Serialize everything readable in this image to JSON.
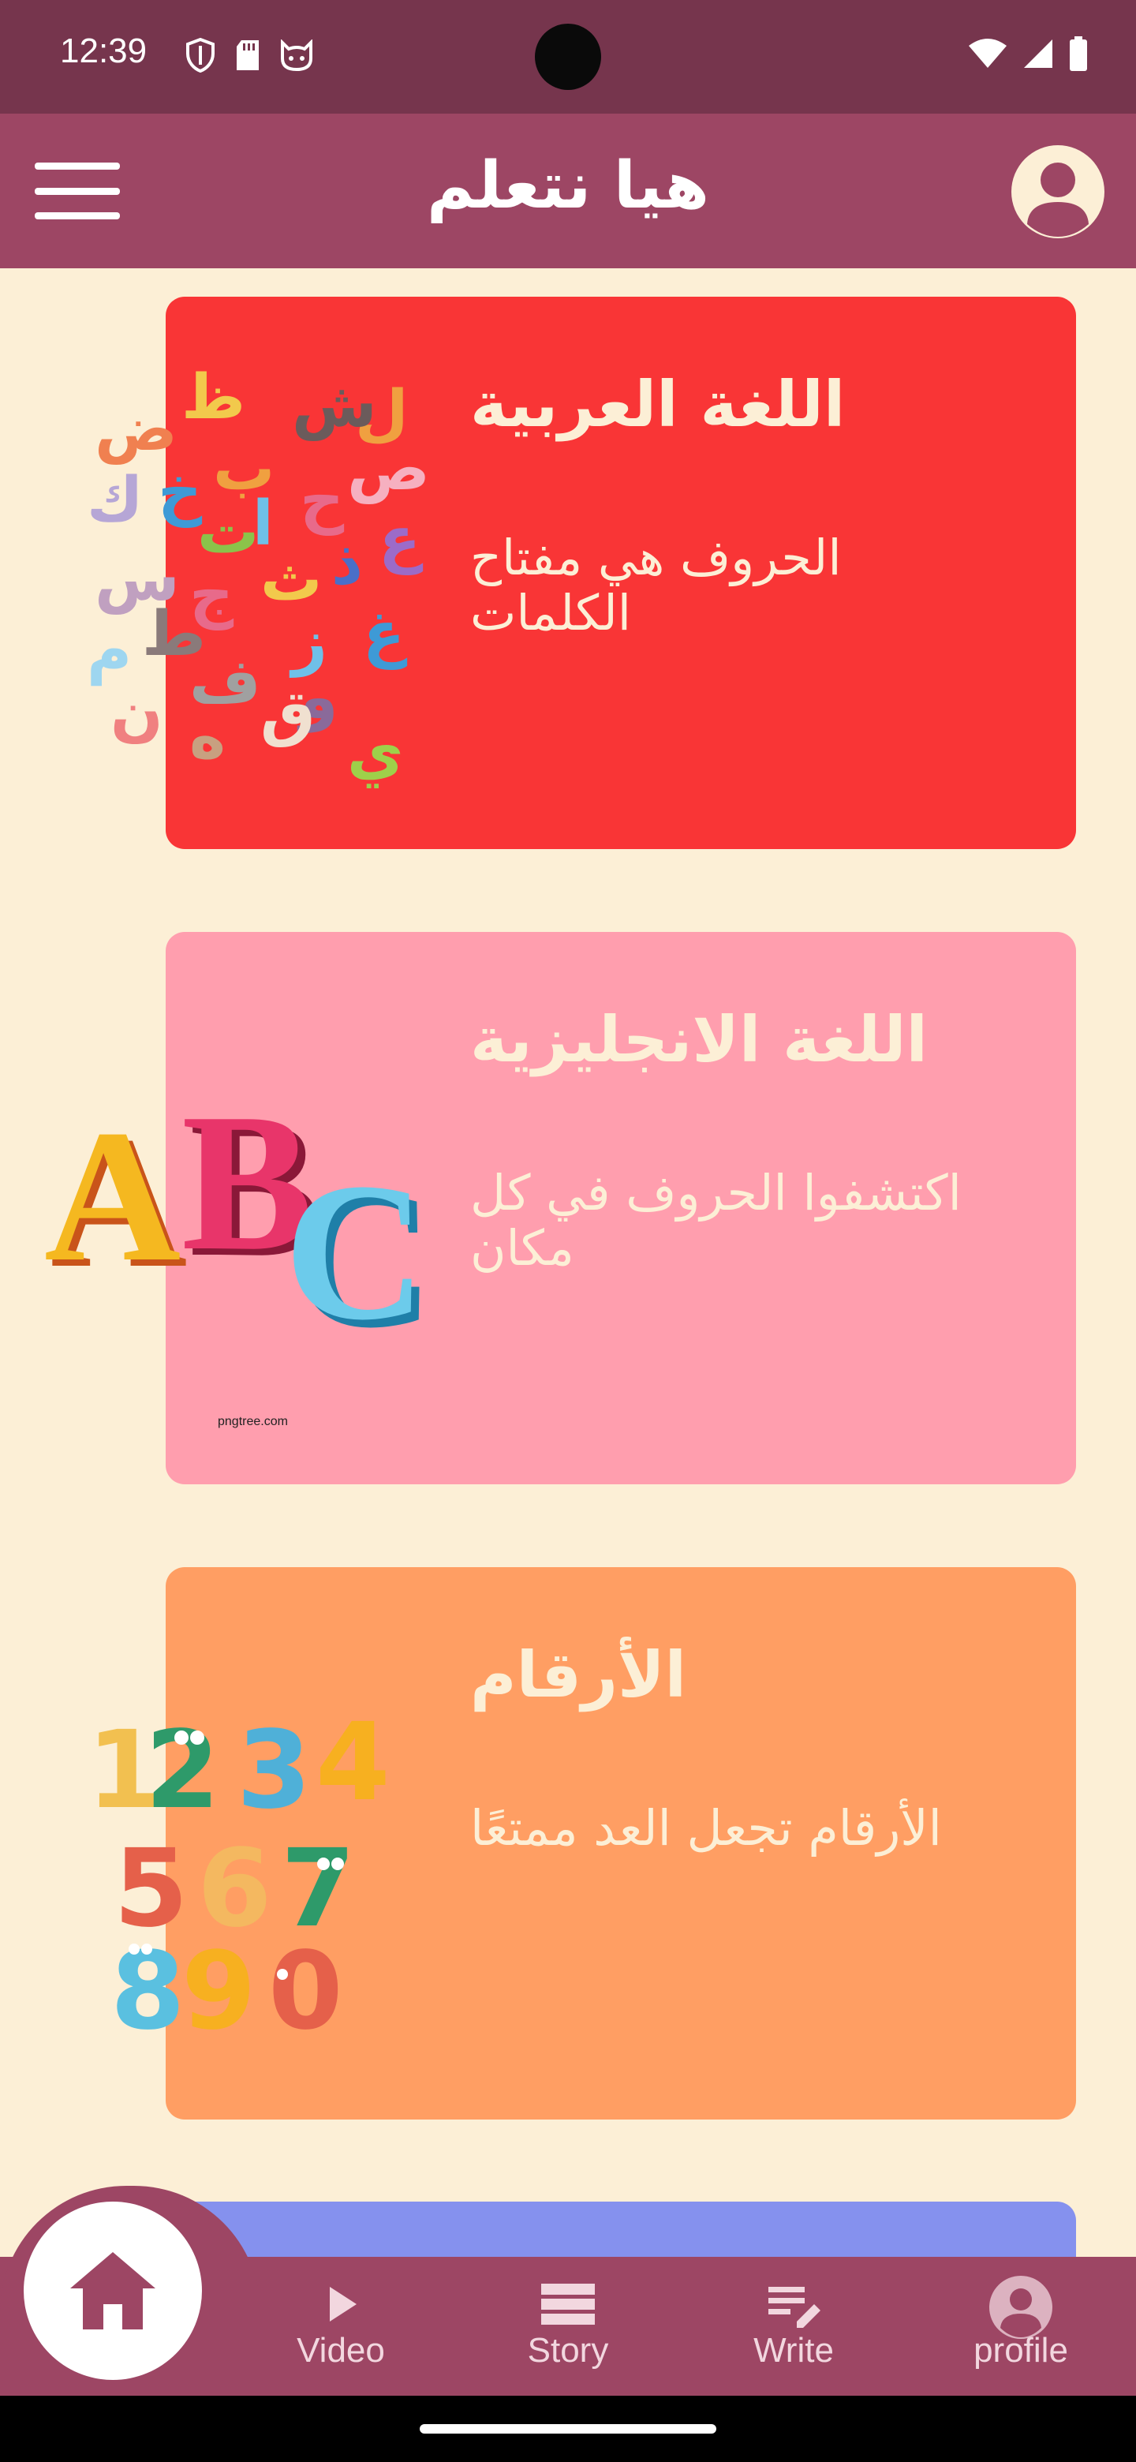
{
  "status_bar": {
    "time": "12:39"
  },
  "app_bar": {
    "title": "هيا نتعلم"
  },
  "cards": [
    {
      "title": "اللغة العربية",
      "description": "الحروف هي مفتاح الكلمات",
      "color": "#F93536"
    },
    {
      "title": "اللغة الانجليزية",
      "description": "اكتشفوا الحروف في كل مكان",
      "color": "#FF9EAE",
      "watermark": "pngtree.com",
      "art_text": [
        "A",
        "B",
        "C"
      ]
    },
    {
      "title": "الأرقام",
      "description": "الأرقام تجعل العد ممتعًا",
      "color": "#FF9E63",
      "art_text": [
        "1",
        "2",
        "3",
        "4",
        "5",
        "6",
        "7",
        "8",
        "9",
        "0"
      ]
    },
    {
      "color": "#8591EE"
    }
  ],
  "arabic_letters": [
    "ل",
    "ش",
    "ظ",
    "ض",
    "ص",
    "ح",
    "ب",
    "خ",
    "ك",
    "ا",
    "ت",
    "ع",
    "ذ",
    "ث",
    "س",
    "ج",
    "ط",
    "م",
    "ز",
    "غ",
    "ن",
    "ف",
    "و",
    "ق",
    "ه",
    "ي"
  ],
  "bottom_nav": {
    "items": [
      {
        "label": "Video",
        "icon": "play-icon"
      },
      {
        "label": "Story",
        "icon": "list-icon"
      },
      {
        "label": "Write",
        "icon": "write-icon"
      },
      {
        "label": "profile",
        "icon": "account-icon"
      }
    ],
    "home_icon": "home-icon"
  },
  "colors": {
    "status_bar": "#76354D",
    "app_bar": "#9D4664",
    "background": "#FCEFD6"
  }
}
